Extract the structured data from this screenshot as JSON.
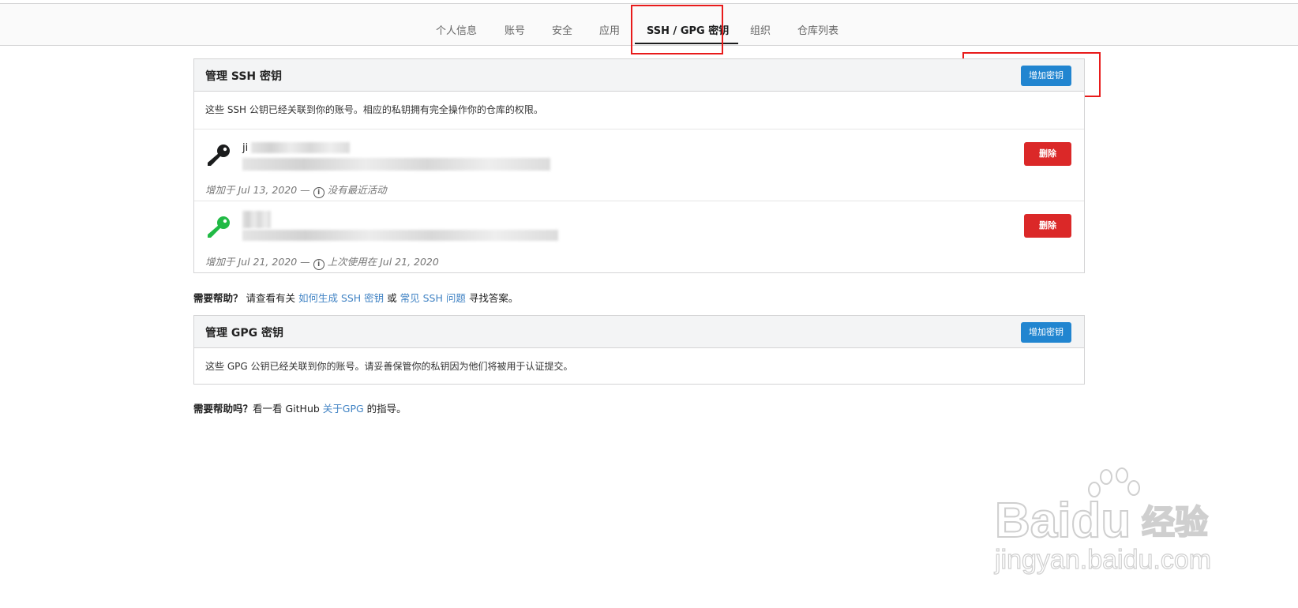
{
  "nav": {
    "items": [
      {
        "label": "个人信息",
        "active": false
      },
      {
        "label": "账号",
        "active": false
      },
      {
        "label": "安全",
        "active": false
      },
      {
        "label": "应用",
        "active": false
      },
      {
        "label": "SSH / GPG 密钥",
        "active": true
      },
      {
        "label": "组织",
        "active": false
      },
      {
        "label": "仓库列表",
        "active": false
      }
    ]
  },
  "ssh": {
    "title": "管理 SSH 密钥",
    "add_button": "增加密钥",
    "description": "这些 SSH 公钥已经关联到你的账号。相应的私钥拥有完全操作你的仓库的权限。",
    "keys": [
      {
        "name": "ji",
        "fingerprint_visible": "...9j0.-MOMFN0Ok",
        "meta": "增加于 Jul 13, 2020 — ",
        "activity": "没有最近活动",
        "delete_label": "删除",
        "icon_color": "#1b1c1d"
      },
      {
        "name": "",
        "fingerprint_visible": "",
        "meta": "增加于 Jul 21, 2020 — ",
        "activity": "上次使用在 Jul 21, 2020",
        "delete_label": "删除",
        "icon_color": "#21ba45"
      }
    ],
    "help": {
      "prefix": "需要帮助？",
      "text1": " 请查看有关 ",
      "link1": "如何生成 SSH 密钥",
      "text2": " 或 ",
      "link2": "常见 SSH 问题",
      "text3": " 寻找答案。"
    }
  },
  "gpg": {
    "title": "管理 GPG 密钥",
    "add_button": "增加密钥",
    "description": "这些 GPG 公钥已经关联到你的账号。请妥善保管你的私钥因为他们将被用于认证提交。",
    "help": {
      "prefix": "需要帮助吗？",
      "text1": "看一看 GitHub ",
      "link1": "关于GPG",
      "text2": " 的指导。"
    }
  },
  "watermark": {
    "brand": "Baidu",
    "brand_cn": "经验",
    "url": "jingyan.baidu.com"
  },
  "colors": {
    "primary_blue": "#2185d0",
    "danger_red": "#db2828",
    "link_blue": "#4183c4",
    "highlight_red": "#e81b1b"
  }
}
